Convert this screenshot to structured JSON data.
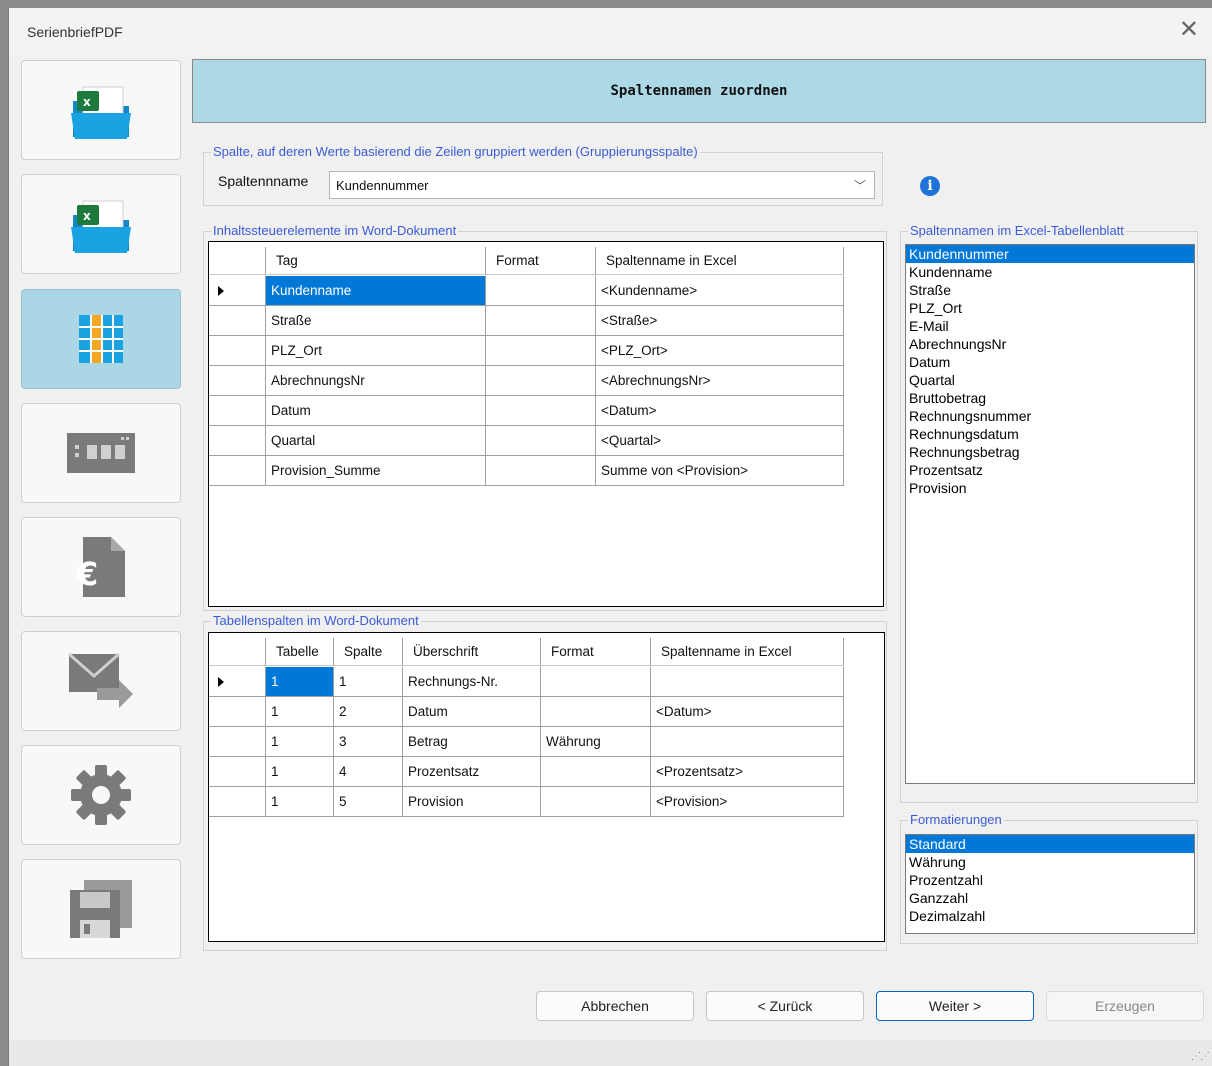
{
  "window": {
    "title": "SerienbriefPDF"
  },
  "sidebar": {
    "items": [
      {
        "icon": "excel-folder-icon"
      },
      {
        "icon": "excel-folder-icon"
      },
      {
        "icon": "table-column-icon",
        "active": true
      },
      {
        "icon": "layout-grid-icon"
      },
      {
        "icon": "euro-document-icon"
      },
      {
        "icon": "email-forward-icon"
      },
      {
        "icon": "gear-icon"
      },
      {
        "icon": "floppy-disk-icon"
      }
    ]
  },
  "header": {
    "title": "Spaltennamen zuordnen"
  },
  "grouping": {
    "legend": "Spalte, auf deren Werte basierend die Zeilen gruppiert werden (Gruppierungsspalte)",
    "label": "Spaltennname",
    "value": "Kundennummer"
  },
  "content_controls": {
    "legend": "Inhaltssteuerelemente im Word-Dokument",
    "columns": [
      "Tag",
      "Format",
      "Spaltenname in Excel"
    ],
    "rows": [
      {
        "tag": "Kundenname",
        "format": "",
        "excel": "<Kundenname>"
      },
      {
        "tag": "Straße",
        "format": "",
        "excel": "<Straße>"
      },
      {
        "tag": "PLZ_Ort",
        "format": "",
        "excel": "<PLZ_Ort>"
      },
      {
        "tag": "AbrechnungsNr",
        "format": "",
        "excel": "<AbrechnungsNr>"
      },
      {
        "tag": "Datum",
        "format": "",
        "excel": "<Datum>"
      },
      {
        "tag": "Quartal",
        "format": "",
        "excel": "<Quartal>"
      },
      {
        "tag": "Provision_Summe",
        "format": "",
        "excel": "Summe von <Provision>"
      }
    ]
  },
  "table_columns": {
    "legend": "Tabellenspalten im Word-Dokument",
    "columns": [
      "Tabelle",
      "Spalte",
      "Überschrift",
      "Format",
      "Spaltenname in Excel"
    ],
    "rows": [
      {
        "tabelle": "1",
        "spalte": "1",
        "ueberschrift": "Rechnungs-Nr.",
        "format": "",
        "excel": ""
      },
      {
        "tabelle": "1",
        "spalte": "2",
        "ueberschrift": "Datum",
        "format": "",
        "excel": "<Datum>"
      },
      {
        "tabelle": "1",
        "spalte": "3",
        "ueberschrift": "Betrag",
        "format": "Währung",
        "excel": ""
      },
      {
        "tabelle": "1",
        "spalte": "4",
        "ueberschrift": "Prozentsatz",
        "format": "",
        "excel": "<Prozentsatz>"
      },
      {
        "tabelle": "1",
        "spalte": "5",
        "ueberschrift": "Provision",
        "format": "",
        "excel": "<Provision>"
      }
    ]
  },
  "excel_columns": {
    "legend": "Spaltennamen im Excel-Tabellenblatt",
    "items": [
      "Kundennummer",
      "Kundenname",
      "Straße",
      "PLZ_Ort",
      "E-Mail",
      "AbrechnungsNr",
      "Datum",
      "Quartal",
      "Bruttobetrag",
      "Rechnungsnummer",
      "Rechnungsdatum",
      "Rechnungsbetrag",
      "Prozentsatz",
      "Provision"
    ],
    "selected": "Kundennummer"
  },
  "formats": {
    "legend": "Formatierungen",
    "items": [
      "Standard",
      "Währung",
      "Prozentzahl",
      "Ganzzahl",
      "Dezimalzahl"
    ],
    "selected": "Standard"
  },
  "buttons": {
    "cancel": "Abbrechen",
    "back": "< Zurück",
    "next": "Weiter >",
    "generate": "Erzeugen"
  },
  "colors": {
    "header_bg": "#add8e6",
    "active_sidebar": "#aad6e6",
    "selection": "#0078d7",
    "legend_text": "#3b5bd6",
    "excel_green": "#1d7a3d",
    "folder_blue": "#1aa3e0"
  }
}
